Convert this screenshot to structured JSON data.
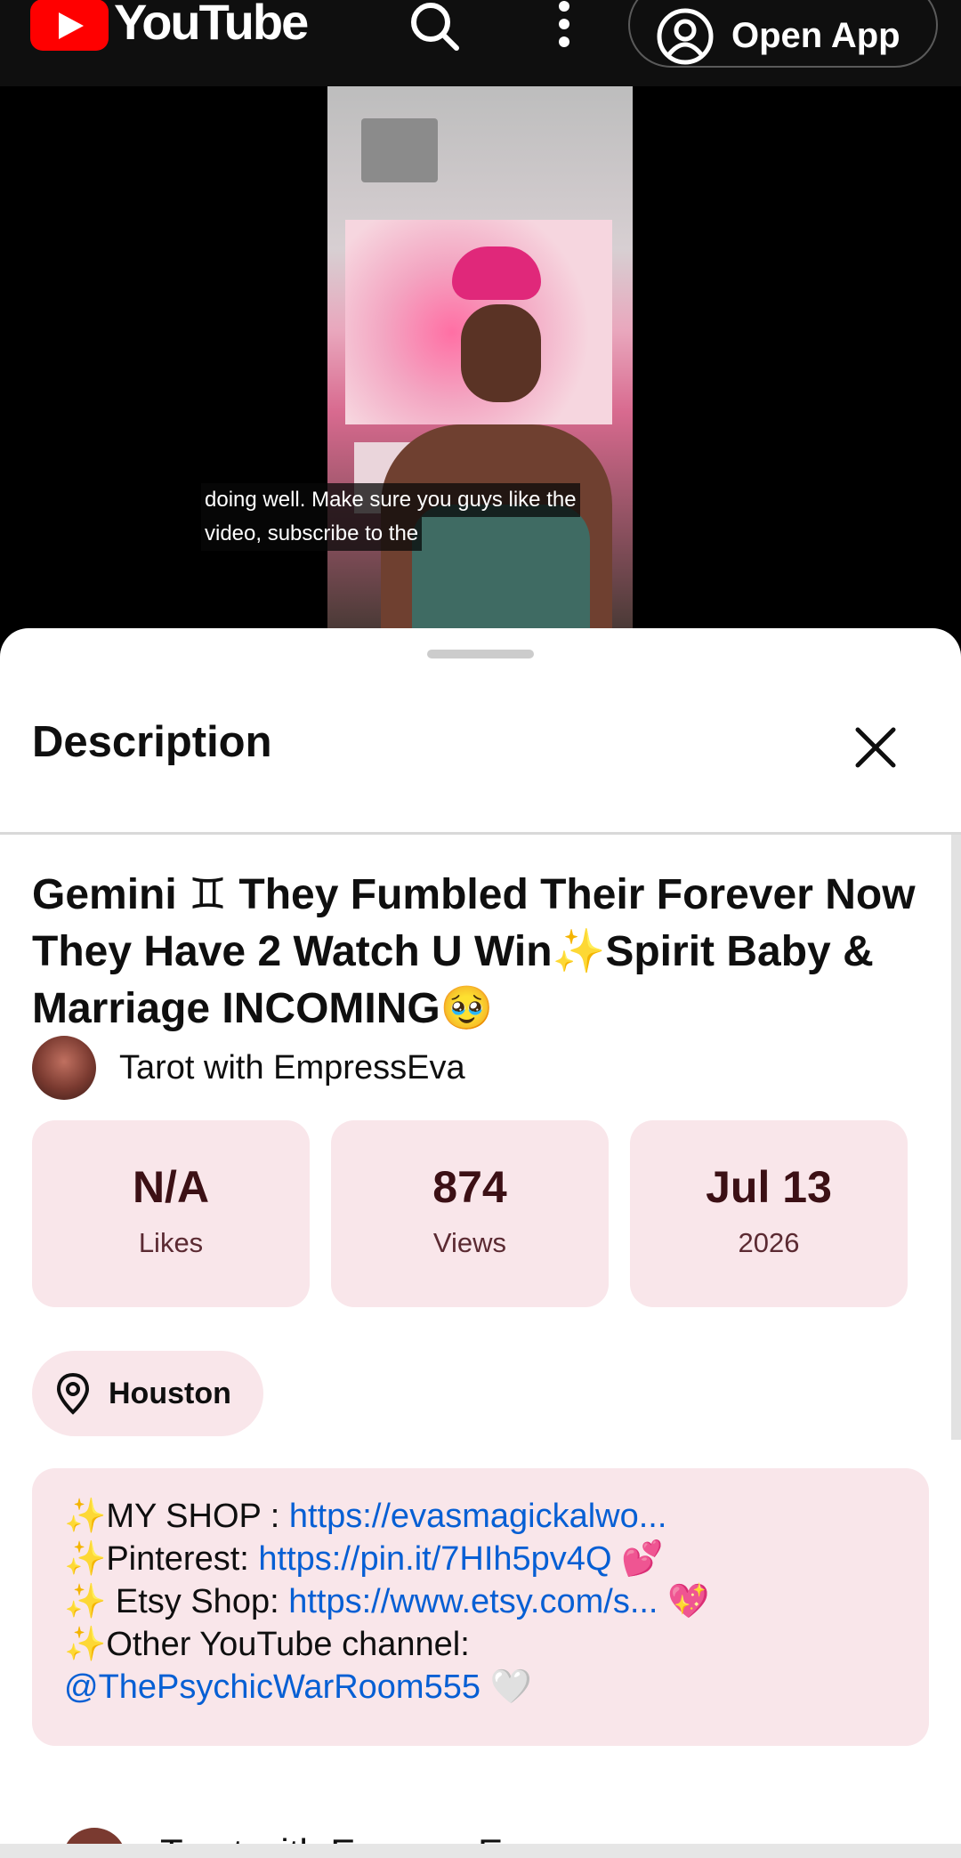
{
  "topbar": {
    "logo_text": "YouTube",
    "open_app_label": "Open App"
  },
  "video": {
    "captions": [
      "doing well. Make sure you guys like the",
      "video, subscribe to the"
    ]
  },
  "sheet": {
    "title": "Description"
  },
  "details": {
    "title": "Gemini ♊ They Fumbled Their Forever Now They Have 2 Watch U Win✨Spirit Baby & Marriage INCOMING🥹",
    "channel_name": "Tarot with EmpressEva",
    "stats": [
      {
        "value": "N/A",
        "label": "Likes"
      },
      {
        "value": "874",
        "label": "Views"
      },
      {
        "value": "Jul 13",
        "label": "2026"
      }
    ],
    "location": "Houston"
  },
  "description": {
    "line1_prefix": "✨MY SHOP : ",
    "line1_link": "https://evasmagickalwo...",
    "line2_prefix": "✨Pinterest: ",
    "line2_link": "https://pin.it/7HIh5pv4Q",
    "line2_suffix": " 💕",
    "line3_prefix": "✨ Etsy Shop: ",
    "line3_link": "https://www.etsy.com/s...",
    "line3_suffix": " 💖",
    "line4": "✨Other YouTube channel:",
    "line5_link": "@ThePsychicWarRoom555",
    "line5_suffix": " 🤍"
  },
  "next_section": {
    "channel_name": "Tarot with EmpressEva"
  },
  "colors": {
    "brand_red": "#ff0000",
    "link_blue": "#065fd4",
    "card_bg": "#f9e6ea"
  }
}
